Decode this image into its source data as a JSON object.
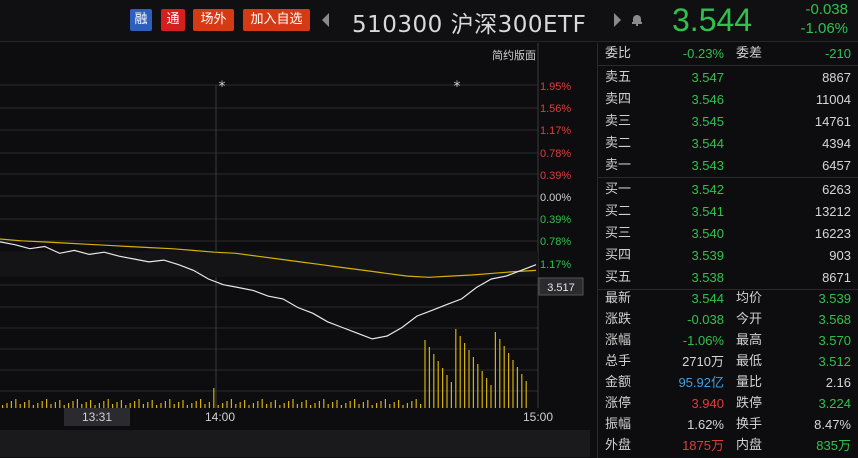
{
  "header": {
    "badge_rong": "融",
    "badge_tong": "通",
    "badge_chang": "场外",
    "badge_add": "加入自选",
    "title": "510300 沪深300ETF",
    "price": "3.544",
    "change_abs": "-0.038",
    "change_pct": "-1.06%",
    "colors": {
      "down": "#2fc14e",
      "up": "#e03b3b"
    }
  },
  "chart": {
    "version_label": "简约版面",
    "scale_labels": [
      "1.95%",
      "1.56%",
      "1.17%",
      "0.78%",
      "0.39%",
      "0.00%",
      "0.39%",
      "0.78%",
      "1.17%"
    ],
    "cursor_price": "3.517",
    "time_labels": [
      "13:31",
      "14:00",
      "15:00"
    ],
    "marker": "*"
  },
  "chart_data": {
    "type": "line",
    "title": "",
    "xlabel": "",
    "ylabel": "",
    "x_range": [
      "13:31",
      "15:00"
    ],
    "ylim_pct": [
      -1.17,
      1.95
    ],
    "series": [
      {
        "values_pct": [
          -0.8,
          -0.85,
          -0.92,
          -0.88,
          -1.0,
          -0.95,
          -1.02,
          -0.98,
          -1.05,
          -1.1,
          -1.15,
          -1.12,
          -1.2,
          -1.3,
          -1.45,
          -1.55,
          -1.6,
          -1.65,
          -1.75,
          -1.8,
          -1.95,
          -2.05,
          -2.2,
          -2.3,
          -2.4,
          -2.5,
          -2.45,
          -2.3,
          -2.1,
          -2.0,
          -1.9,
          -1.8,
          -1.6,
          -1.45,
          -1.4,
          -1.3,
          -1.2
        ]
      },
      {
        "values_pct": [
          -0.75,
          -0.78,
          -0.8,
          -0.82,
          -0.84,
          -0.86,
          -0.88,
          -0.9,
          -0.92,
          -0.95,
          -0.98,
          -1.0,
          -1.05,
          -1.1,
          -1.15,
          -1.2,
          -1.25,
          -1.3,
          -1.35,
          -1.4,
          -1.42,
          -1.4,
          -1.38,
          -1.35,
          -1.32,
          -1.3
        ]
      }
    ]
  },
  "quote": {
    "weibi_label": "委比",
    "weibi_value": "-0.23%",
    "weicha_label": "委差",
    "weicha_value": "-210",
    "sell": [
      {
        "label": "卖五",
        "price": "3.547",
        "vol": "8867"
      },
      {
        "label": "卖四",
        "price": "3.546",
        "vol": "11004"
      },
      {
        "label": "卖三",
        "price": "3.545",
        "vol": "14761"
      },
      {
        "label": "卖二",
        "price": "3.544",
        "vol": "4394"
      },
      {
        "label": "卖一",
        "price": "3.543",
        "vol": "6457"
      }
    ],
    "buy": [
      {
        "label": "买一",
        "price": "3.542",
        "vol": "6263"
      },
      {
        "label": "买二",
        "price": "3.541",
        "vol": "13212"
      },
      {
        "label": "买三",
        "price": "3.540",
        "vol": "16223"
      },
      {
        "label": "买四",
        "price": "3.539",
        "vol": "903"
      },
      {
        "label": "买五",
        "price": "3.538",
        "vol": "8671"
      }
    ],
    "stats": [
      {
        "l1": "最新",
        "v1": "3.544",
        "c1": "g",
        "l2": "均价",
        "v2": "3.539",
        "c2": "g"
      },
      {
        "l1": "涨跌",
        "v1": "-0.038",
        "c1": "g",
        "l2": "今开",
        "v2": "3.568",
        "c2": "g"
      },
      {
        "l1": "涨幅",
        "v1": "-1.06%",
        "c1": "g",
        "l2": "最高",
        "v2": "3.570",
        "c2": "g"
      },
      {
        "l1": "总手",
        "v1": "2710万",
        "c1": "w",
        "l2": "最低",
        "v2": "3.512",
        "c2": "g"
      },
      {
        "l1": "金额",
        "v1": "95.92亿",
        "c1": "b",
        "l2": "量比",
        "v2": "2.16",
        "c2": "w"
      },
      {
        "l1": "涨停",
        "v1": "3.940",
        "c1": "r",
        "l2": "跌停",
        "v2": "3.224",
        "c2": "g"
      },
      {
        "l1": "振幅",
        "v1": "1.62%",
        "c1": "w",
        "l2": "换手",
        "v2": "8.47%",
        "c2": "w"
      },
      {
        "l1": "外盘",
        "v1": "1875万",
        "c1": "r",
        "l2": "内盘",
        "v2": "835万",
        "c2": "g"
      }
    ]
  }
}
